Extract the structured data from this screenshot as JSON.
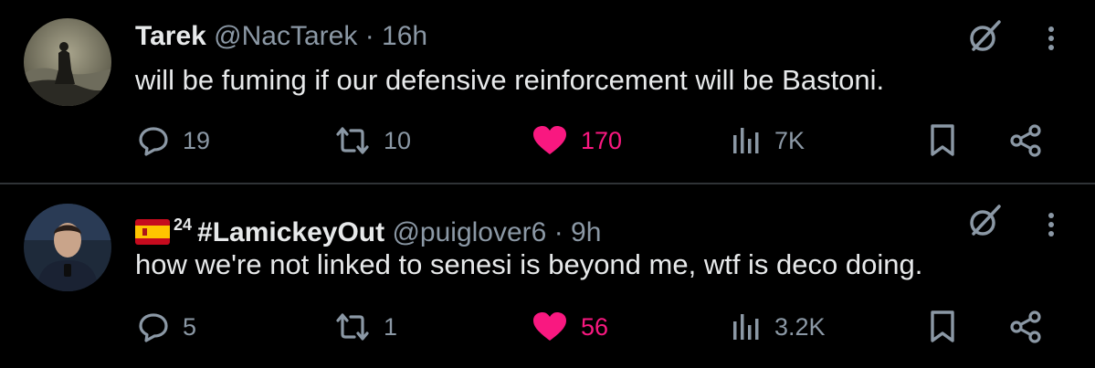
{
  "tweets": [
    {
      "name": "Tarek",
      "handle": "@NacTarek",
      "separator": "·",
      "time": "16h",
      "text": "will be fuming if our defensive reinforcement will be Bastoni.",
      "avatar_icon": "avatar-wanderer-painting",
      "stats": {
        "replies": "19",
        "retweets": "10",
        "likes": "170",
        "views": "7K"
      },
      "liked": true
    },
    {
      "name_prefix_flag": "spain-flag-icon",
      "name_sup": "24",
      "name": "#LamickeyOut",
      "handle": "@puiglover6",
      "separator": "·",
      "time": "9h",
      "text": "how we're not linked to senesi is beyond me, wtf is deco doing.",
      "avatar_icon": "avatar-man-photo",
      "stats": {
        "replies": "5",
        "retweets": "1",
        "likes": "56",
        "views": "3.2K"
      },
      "liked": true
    }
  ],
  "colors": {
    "background": "#000000",
    "text": "#e7e9ea",
    "muted": "#8b98a5",
    "like": "#f91880",
    "divider": "#2f3336"
  }
}
